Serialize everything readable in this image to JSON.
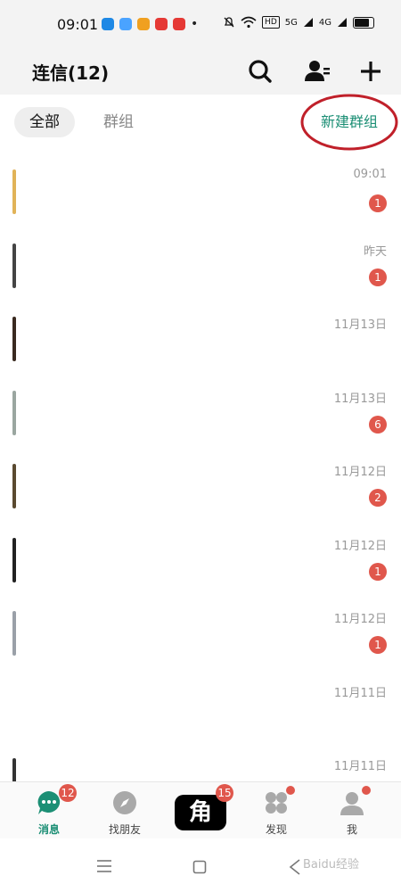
{
  "status_bar": {
    "time": "09:01",
    "app_icons": [
      "#1e88e5",
      "#4aa3ff",
      "#f0a020",
      "#e53935",
      "#e53935"
    ],
    "signal1": "HD",
    "signal2": "5G",
    "signal3": "4G"
  },
  "header": {
    "title": "连信(12)"
  },
  "tabs": {
    "all": "全部",
    "group": "群组",
    "new_group": "新建群组"
  },
  "conversations": [
    {
      "time": "09:01",
      "badge": "1",
      "avatar_color": "#e1b358"
    },
    {
      "time": "昨天",
      "badge": "1",
      "avatar_color": "#444444"
    },
    {
      "time": "11月13日",
      "badge": "",
      "avatar_color": "#3a2a20"
    },
    {
      "time": "11月13日",
      "badge": "6",
      "avatar_color": "#9aa6a0"
    },
    {
      "time": "11月12日",
      "badge": "2",
      "avatar_color": "#5a4a30"
    },
    {
      "time": "11月12日",
      "badge": "1",
      "avatar_color": "#222222"
    },
    {
      "time": "11月12日",
      "badge": "1",
      "avatar_color": "#9aa0a8"
    },
    {
      "time": "11月11日",
      "badge": "",
      "avatar_color": "#ffffff"
    },
    {
      "time": "11月11日",
      "badge": "",
      "avatar_color": "#333333"
    }
  ],
  "bottom_nav": {
    "messages": {
      "label": "消息",
      "badge": "12"
    },
    "find_friends": {
      "label": "找朋友"
    },
    "center": {
      "glyph": "角",
      "badge": "15"
    },
    "discover": {
      "label": "发现"
    },
    "me": {
      "label": "我"
    }
  },
  "colors": {
    "accent": "#1c8f75",
    "badge": "#e0574c",
    "annotation": "#c0202a"
  },
  "watermark": "Baidu经验"
}
